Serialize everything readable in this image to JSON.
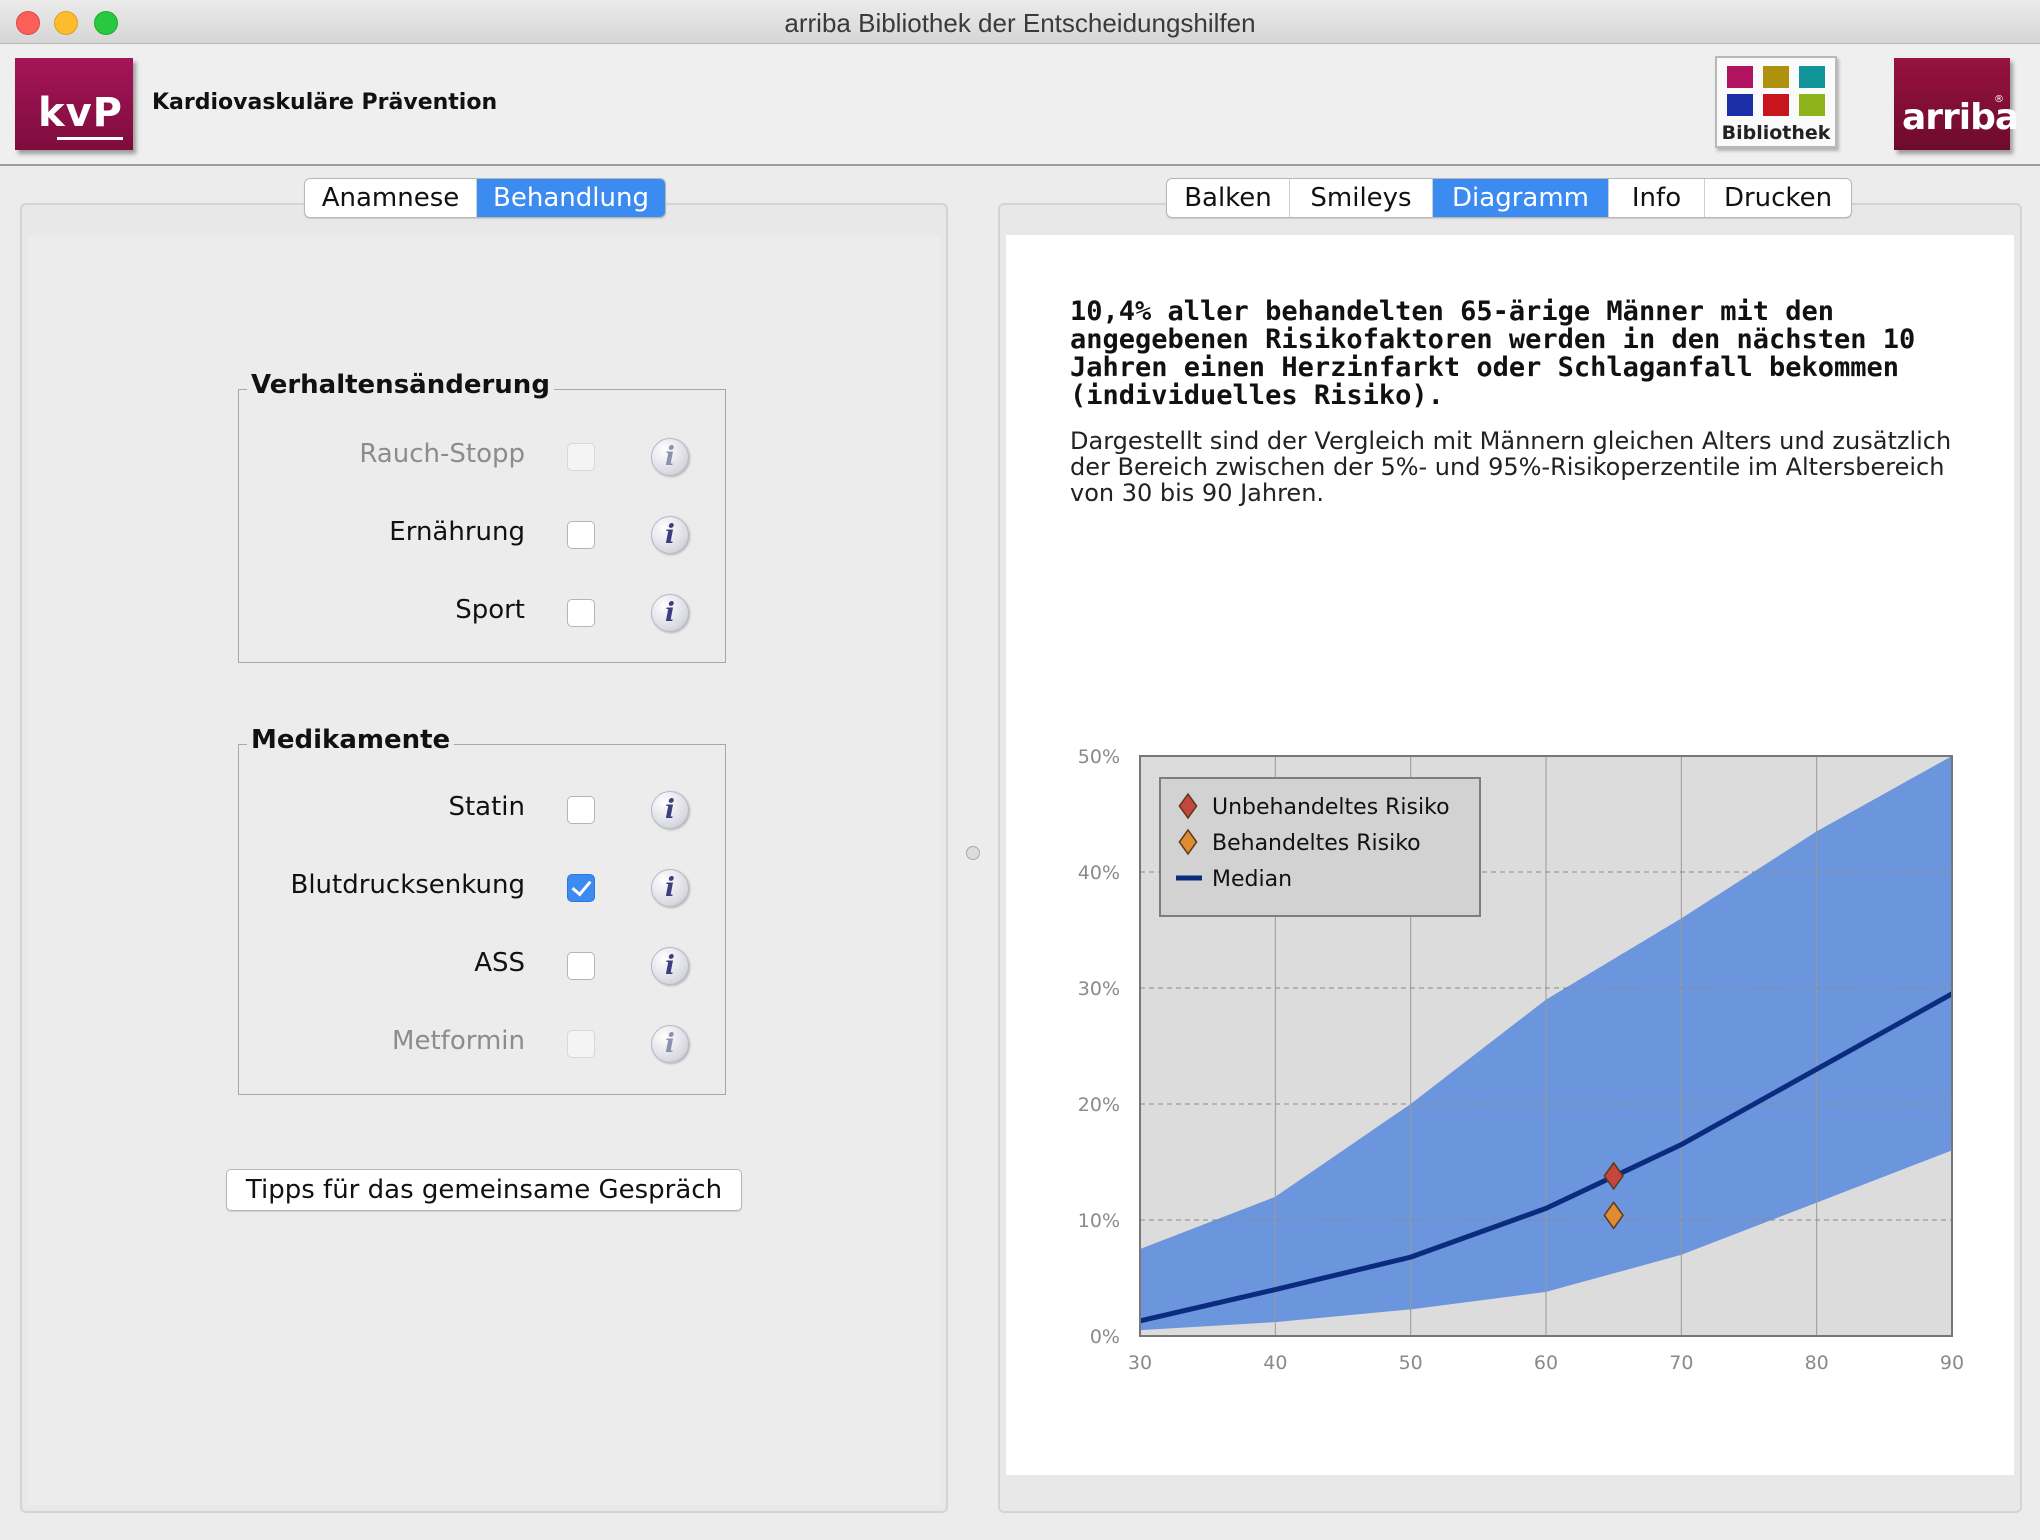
{
  "window": {
    "title": "arriba Bibliothek der Entscheidungshilfen"
  },
  "header": {
    "kvp_logo_text": "kvP",
    "app_name": "Kardiovaskuläre Prävention",
    "library_label": "Bibliothek",
    "arriba_logo_text": "arriba"
  },
  "left_tabs": [
    {
      "label": "Anamnese",
      "active": false
    },
    {
      "label": "Behandlung",
      "active": true
    }
  ],
  "right_tabs": [
    {
      "label": "Balken",
      "active": false
    },
    {
      "label": "Smileys",
      "active": false
    },
    {
      "label": "Diagramm",
      "active": true
    },
    {
      "label": "Info",
      "active": false
    },
    {
      "label": "Drucken",
      "active": false
    }
  ],
  "groups": {
    "behavior": {
      "title": "Verhaltensänderung",
      "items": [
        {
          "label": "Rauch-Stopp",
          "checked": false,
          "enabled": false
        },
        {
          "label": "Ernährung",
          "checked": false,
          "enabled": true
        },
        {
          "label": "Sport",
          "checked": false,
          "enabled": true
        }
      ]
    },
    "medication": {
      "title": "Medikamente",
      "items": [
        {
          "label": "Statin",
          "checked": false,
          "enabled": true
        },
        {
          "label": "Blutdrucksenkung",
          "checked": true,
          "enabled": true
        },
        {
          "label": "ASS",
          "checked": false,
          "enabled": true
        },
        {
          "label": "Metformin",
          "checked": false,
          "enabled": false
        }
      ]
    }
  },
  "info_icon_glyph": "i",
  "tips_button_label": "Tipps für das gemeinsame Gespräch",
  "content": {
    "headline": "10,4% aller behandelten 65-ärige Männer mit den angegebenen Risikofaktoren werden in den nächsten 10 Jahren einen Herzinfarkt oder Schlaganfall bekommen (individuelles Risiko).",
    "subtext": "Dargestellt sind der Vergleich mit Männern gleichen Alters und zusätzlich der Bereich zwischen der 5%- und 95%-Risikoperzentile im Altersbereich von 30 bis 90 Jahren."
  },
  "colors": {
    "accent": "#3b8bf0",
    "kvp_logo": "#8e1047",
    "arriba_logo": "#7e0e35",
    "band": "#6b95dc",
    "median": "#0b2b7e",
    "untreated": "#c5463d",
    "treated": "#e08b34",
    "plot_bg": "#dcdcdc"
  },
  "chart_data": {
    "type": "area",
    "xlim": [
      30,
      90
    ],
    "ylim": [
      0,
      50
    ],
    "x_ticks": [
      "30",
      "40",
      "50",
      "60",
      "70",
      "80",
      "90"
    ],
    "y_ticks": [
      "0%",
      "10%",
      "20%",
      "30%",
      "40%",
      "50%"
    ],
    "x": [
      30,
      40,
      50,
      60,
      70,
      80,
      90
    ],
    "band_lower": [
      0.5,
      1.2,
      2.3,
      3.8,
      7,
      11.5,
      16
    ],
    "band_upper": [
      7.5,
      12,
      20,
      29,
      36,
      43.5,
      50
    ],
    "median": [
      1.3,
      4,
      6.8,
      11,
      16.5,
      23,
      29.5
    ],
    "points": [
      {
        "name": "Unbehandeltes Risiko",
        "x": 65,
        "y": 13.8,
        "color": "#c5463d"
      },
      {
        "name": "Behandeltes Risiko",
        "x": 65,
        "y": 10.4,
        "color": "#e08b34"
      }
    ],
    "legend": [
      "Unbehandeltes Risiko",
      "Behandeltes Risiko",
      "Median"
    ],
    "legend_position": "top-left",
    "grid": true
  }
}
